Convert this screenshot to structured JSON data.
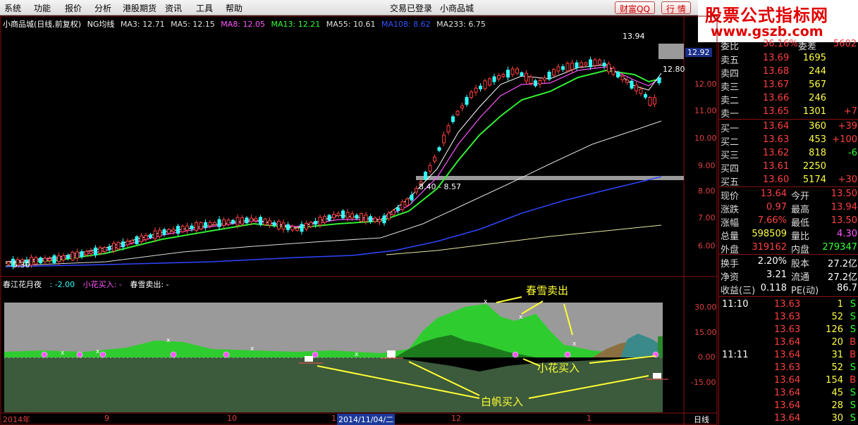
{
  "menu": {
    "items": [
      "系统",
      "功能",
      "报价",
      "分析",
      "港股期货",
      "资讯",
      "工具",
      "帮助"
    ],
    "login_status": "交易已登录",
    "stock_title": "小商品城",
    "btn_wealth": "财富QQ",
    "btn_quote": "行 情"
  },
  "watermark": {
    "title": "股票公式指标网",
    "url": "www.gszb.com"
  },
  "main_chart": {
    "name": "小商品城(日线,前复权)",
    "indicator": "NG均线",
    "ma": [
      {
        "label": "MA3: 12.71",
        "color": "#e0e0e0"
      },
      {
        "label": "MA5: 12.15",
        "color": "#e0e0e0"
      },
      {
        "label": "MA8: 12.05",
        "color": "#ff55ff"
      },
      {
        "label": "MA13: 12.21",
        "color": "#33ff33"
      },
      {
        "label": "MA55: 10.61",
        "color": "#e0e0e0"
      },
      {
        "label": "MA108: 8.62",
        "color": "#3355ff"
      },
      {
        "label": "MA233: 6.75",
        "color": "#e0e0e0"
      }
    ],
    "price_axis": [
      "12.00",
      "11.00",
      "10.00",
      "9.00",
      "8.00",
      "7.00",
      "6.00"
    ],
    "last_price_tag": "12.92",
    "high_label": "13.94",
    "low_label": "5.30",
    "mark_12_80": "12.80",
    "gap_label": "8.40 - 8.57",
    "chart_data": {
      "type": "line",
      "series_names": [
        "MA3",
        "MA5",
        "MA8",
        "MA13",
        "MA55",
        "MA108",
        "MA233"
      ],
      "latest_values": [
        12.71,
        12.15,
        12.05,
        12.21,
        10.61,
        8.62,
        6.75
      ],
      "high": 13.94,
      "low": 5.3,
      "last": 12.92
    }
  },
  "sub_chart": {
    "name": "春江花月夜",
    "value": ": -2.00",
    "buy_label": "小花买入: -",
    "sell_label": "春雪卖出: -",
    "axis": [
      "30.00",
      "15.00",
      "0.00",
      "-15.00"
    ],
    "annotations": {
      "sell": "春雪卖出",
      "small_buy": "小花买入",
      "sail_buy": "白帆买入"
    }
  },
  "dates": {
    "labels": [
      "2014年",
      "9",
      "10",
      "11",
      "12",
      "1"
    ],
    "selected": "2014/11/04/二",
    "period": "日线"
  },
  "quote": {
    "header": {
      "l1": "委比",
      "v1": "36.16%",
      "l2": "委差",
      "v2": "5602"
    },
    "asks": [
      {
        "label": "卖五",
        "price": "13.69",
        "vol": "1695",
        "chg": ""
      },
      {
        "label": "卖四",
        "price": "13.68",
        "vol": "244",
        "chg": ""
      },
      {
        "label": "卖三",
        "price": "13.67",
        "vol": "567",
        "chg": ""
      },
      {
        "label": "卖二",
        "price": "13.66",
        "vol": "246",
        "chg": ""
      },
      {
        "label": "卖一",
        "price": "13.65",
        "vol": "1301",
        "chg": "+7"
      }
    ],
    "bids": [
      {
        "label": "买一",
        "price": "13.64",
        "vol": "360",
        "chg": "+39"
      },
      {
        "label": "买二",
        "price": "13.63",
        "vol": "453",
        "chg": "+100"
      },
      {
        "label": "买三",
        "price": "13.62",
        "vol": "818",
        "chg": "-6"
      },
      {
        "label": "买四",
        "price": "13.61",
        "vol": "2250",
        "chg": ""
      },
      {
        "label": "买五",
        "price": "13.60",
        "vol": "5174",
        "chg": "+30"
      }
    ],
    "stats": [
      {
        "l1": "现价",
        "v1": "13.64",
        "l2": "今开",
        "v2": "13.50"
      },
      {
        "l1": "涨跌",
        "v1": "0.97",
        "l2": "最高",
        "v2": "13.94"
      },
      {
        "l1": "涨幅",
        "v1": "7.66%",
        "l2": "最低",
        "v2": "13.50"
      },
      {
        "l1": "总量",
        "v1": "598509",
        "l2": "量比",
        "v2": "4.30"
      },
      {
        "l1": "外盘",
        "v1": "319162",
        "l2": "内盘",
        "v2": "279347"
      }
    ],
    "fin": [
      {
        "l1": "换手",
        "v1": "2.20%",
        "l2": "股本",
        "v2": "27.2亿"
      },
      {
        "l1": "净资",
        "v1": "3.21",
        "l2": "流通",
        "v2": "27.2亿"
      },
      {
        "l1": "收益(三)",
        "v1": "0.118",
        "l2": "PE(动)",
        "v2": "86.7"
      }
    ],
    "ticks": [
      {
        "time": "11:10",
        "price": "13.63",
        "vol": "1",
        "side": "S"
      },
      {
        "time": "",
        "price": "13.63",
        "vol": "52",
        "side": "S"
      },
      {
        "time": "",
        "price": "13.63",
        "vol": "126",
        "side": "S"
      },
      {
        "time": "",
        "price": "13.64",
        "vol": "20",
        "side": "B"
      },
      {
        "time": "11:11",
        "price": "13.64",
        "vol": "31",
        "side": "B"
      },
      {
        "time": "",
        "price": "13.63",
        "vol": "52",
        "side": "S"
      },
      {
        "time": "",
        "price": "13.64",
        "vol": "154",
        "side": "B"
      },
      {
        "time": "",
        "price": "13.64",
        "vol": "45",
        "side": "S"
      },
      {
        "time": "",
        "price": "13.64",
        "vol": "28",
        "side": "S"
      },
      {
        "time": "",
        "price": "13.64",
        "vol": "30",
        "side": "S"
      }
    ]
  }
}
